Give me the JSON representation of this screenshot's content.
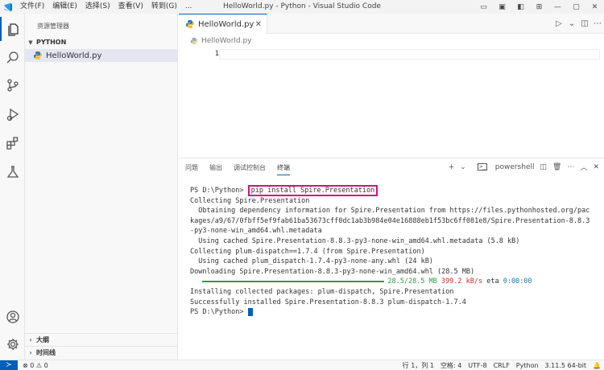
{
  "window": {
    "title": "HelloWorld.py - Python - Visual Studio Code",
    "menu": [
      "文件(F)",
      "编辑(E)",
      "选择(S)",
      "查看(V)",
      "转到(G)",
      "..."
    ]
  },
  "sidebar": {
    "header": "资源管理器",
    "folder": "PYTHON",
    "file": "HelloWorld.py",
    "bottom_sections": [
      "大纲",
      "时间线"
    ]
  },
  "editor": {
    "tab_label": "HelloWorld.py",
    "breadcrumb": "HelloWorld.py",
    "line_number": "1"
  },
  "panel": {
    "tabs": [
      "问题",
      "输出",
      "调试控制台",
      "终端"
    ],
    "shell_label": "powershell",
    "terminal": {
      "prompt": "PS D:\\Python> ",
      "command": "pip install Spire.Presentation",
      "lines": [
        "Collecting Spire.Presentation",
        "  Obtaining dependency information for Spire.Presentation from https://files.pythonhosted.org/pac",
        "kages/a9/67/0fbff5ef9fab61ba53673cff0dc1ab3b984e04e16888eb1f53bc6ff081e8/Spire.Presentation-8.8.3",
        "-py3-none-win_amd64.whl.metadata",
        "  Using cached Spire.Presentation-8.8.3-py3-none-win_amd64.whl.metadata (5.8 kB)",
        "Collecting plum-dispatch==1.7.4 (from Spire.Presentation)",
        "  Using cached plum_dispatch-1.7.4-py3-none-any.whl (24 kB)",
        "Downloading Spire.Presentation-8.8.3-py3-none-win_amd64.whl (28.5 MB)"
      ],
      "progress_fraction": 1.0,
      "progress_size": "28.5/28.5 MB",
      "progress_speed": "399.2 kB/s",
      "progress_eta_label": "eta",
      "progress_eta": "0:00:00",
      "lines_after": [
        "Installing collected packages: plum-dispatch, Spire.Presentation",
        "Successfully installed Spire.Presentation-8.8.3 plum-dispatch-1.7.4"
      ],
      "final_prompt": "PS D:\\Python> "
    }
  },
  "statusbar": {
    "problems": "⊗ 0 ⚠ 0",
    "items": [
      "行 1，列 1",
      "空格: 4",
      "UTF-8",
      "CRLF",
      "Python",
      "3.11.5 64-bit"
    ]
  },
  "colors": {
    "accent": "#005fb8",
    "highlight_box": "#d0157a",
    "progress_green": "#2e9e3a"
  },
  "icons": {
    "activity": [
      "explorer-icon",
      "search-icon",
      "source-control-icon",
      "run-debug-icon",
      "extensions-icon",
      "testing-icon",
      "account-icon",
      "settings-gear-icon"
    ]
  }
}
